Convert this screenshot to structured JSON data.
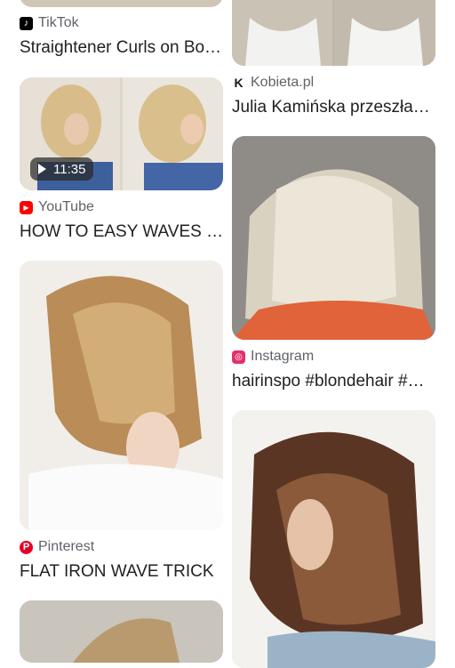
{
  "colors": {
    "tiktok": "#000000",
    "youtube": "#ff0000",
    "kobieta": "#1a1a1a",
    "instagram": "#e1306c",
    "pinterest": "#e60023",
    "source_text": "#5f6368",
    "title_text": "#202124"
  },
  "left_column": [
    {
      "source": "TikTok",
      "source_icon": "tiktok-icon",
      "title": "Straightener Curls on Bo…"
    },
    {
      "source": "YouTube",
      "source_icon": "youtube-icon",
      "title": "HOW TO EASY WAVES …",
      "duration": "11:35"
    },
    {
      "source": "Pinterest",
      "source_icon": "pinterest-icon",
      "title": "FLAT IRON WAVE TRICK"
    }
  ],
  "right_column": [
    {
      "source": "Kobieta.pl",
      "source_icon": "kobieta-k-icon",
      "title": "Julia Kamińska przeszła…"
    },
    {
      "source": "Instagram",
      "source_icon": "instagram-icon",
      "title": "hairinspo #blondehair #…"
    }
  ]
}
